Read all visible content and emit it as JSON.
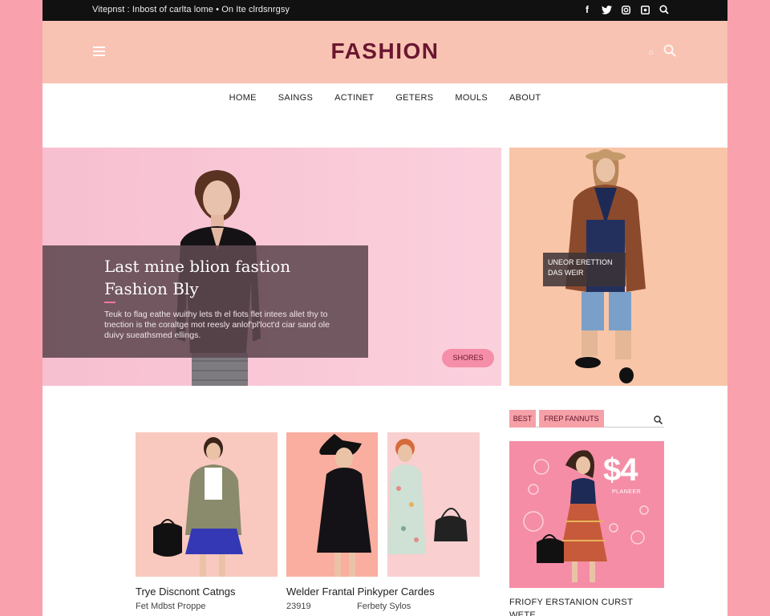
{
  "topbar": {
    "promo_text": "Vitepnst : Inbost of carlta lome • On Ite clrdsnrgsy",
    "social_icons": [
      "facebook-icon",
      "twitter-icon",
      "instagram-icon",
      "pinterest-icon"
    ],
    "search_icon": "search-icon"
  },
  "header": {
    "logo": "FASHION",
    "menu_icon": "hamburger-icon",
    "small_icon_text": "⌂",
    "search_icon": "search-icon",
    "background": "#f9c3b3",
    "logo_color": "#6a1630"
  },
  "nav": {
    "items": [
      "HOME",
      "SAINGS",
      "ACTINET",
      "GETERS",
      "MOULS",
      "ABOUT"
    ]
  },
  "hero": {
    "title_line1": "Last mine blion fastion",
    "title_line2": "Fashion Bly",
    "body": "Teuk to flag eathe wuithy lets th el fiots flet intees allet thy to tnection is the coraltge mot reesly anlof'pl'loct'd ciar sand ole duivy sueathsmed ellings.",
    "button_label": "SHORES"
  },
  "side_feature": {
    "label": "UNEOR ERETTION DAS WEIR"
  },
  "products": [
    {
      "title": "Trye Discnont Catngs",
      "subtitle": "Fet Mdbst Proppe"
    },
    {
      "title": "Welder Frantal Pinkyper Cardes",
      "subtitle": "23919",
      "subtitle2": "Ferbety Sylos"
    }
  ],
  "sidebar_widget": {
    "tab1": "BEST",
    "tab2": "FREP FANNUTS",
    "search_icon": "search-icon",
    "promo_big": "$4",
    "promo_small": "PLANEER",
    "caption_line1": "FRIOFY ERSTANION CURST",
    "caption_line2": "WETE"
  },
  "colors": {
    "page_background": "#f9a2ad",
    "accent_pink": "#f58ea8",
    "deep_wine": "#6a1630"
  }
}
